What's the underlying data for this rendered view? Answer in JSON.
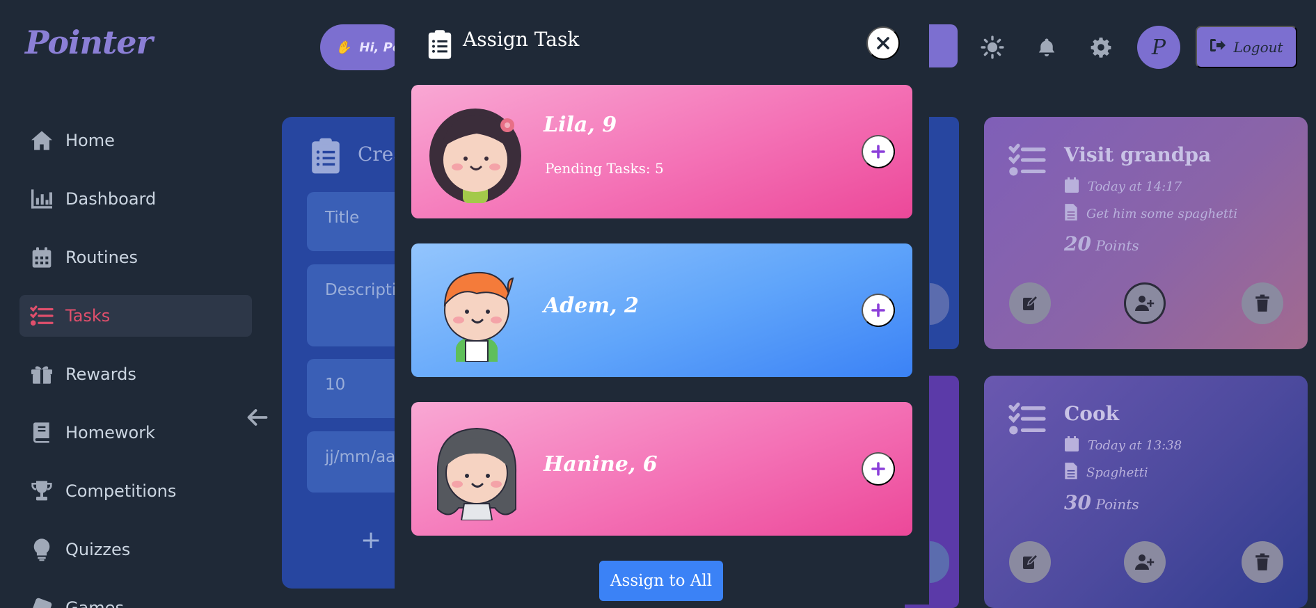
{
  "app": {
    "logo": "Pointer"
  },
  "header": {
    "greeting": "Hi, Po",
    "avatar_letter": "P",
    "logout_label": "Logout",
    "icons": [
      "sun-icon",
      "bell-icon",
      "gear-icon"
    ]
  },
  "sidebar": {
    "items": [
      {
        "label": "Home",
        "icon": "home-icon"
      },
      {
        "label": "Dashboard",
        "icon": "chart-icon"
      },
      {
        "label": "Routines",
        "icon": "calendar-icon"
      },
      {
        "label": "Tasks",
        "icon": "tasks-icon",
        "active": true
      },
      {
        "label": "Rewards",
        "icon": "gift-icon"
      },
      {
        "label": "Homework",
        "icon": "book-icon"
      },
      {
        "label": "Competitions",
        "icon": "trophy-icon"
      },
      {
        "label": "Quizzes",
        "icon": "lightbulb-icon"
      },
      {
        "label": "Games",
        "icon": "dice-icon"
      }
    ]
  },
  "create_form": {
    "title_partial": "Crea",
    "title_placeholder": "Title",
    "description_placeholder": "Descripti",
    "points_value": "10",
    "date_placeholder": "jj/mm/aa"
  },
  "tasks": [
    {
      "title": "Visit grandpa",
      "date": "Today at 14:17",
      "description": "Get him some spaghetti",
      "points_num": "20",
      "points_label": "Points"
    },
    {
      "title": "Cook",
      "date": "Today at 13:38",
      "description": "Spaghetti",
      "points_num": "30",
      "points_label": "Points"
    }
  ],
  "modal": {
    "title": "Assign Task",
    "kids": [
      {
        "name": "Lila, 9",
        "pending": "Pending Tasks: 5",
        "theme": "pink"
      },
      {
        "name": "Adem, 2",
        "pending": "",
        "theme": "blue"
      },
      {
        "name": "Hanine, 6",
        "pending": "",
        "theme": "pink"
      }
    ],
    "assign_all_label": "Assign to All"
  },
  "colors": {
    "background": "#1f2937",
    "accent_purple": "#7c6fd0",
    "active_nav": "#e04f6c",
    "primary_blue": "#3b82f6",
    "plus_purple": "#8b3fd9"
  }
}
